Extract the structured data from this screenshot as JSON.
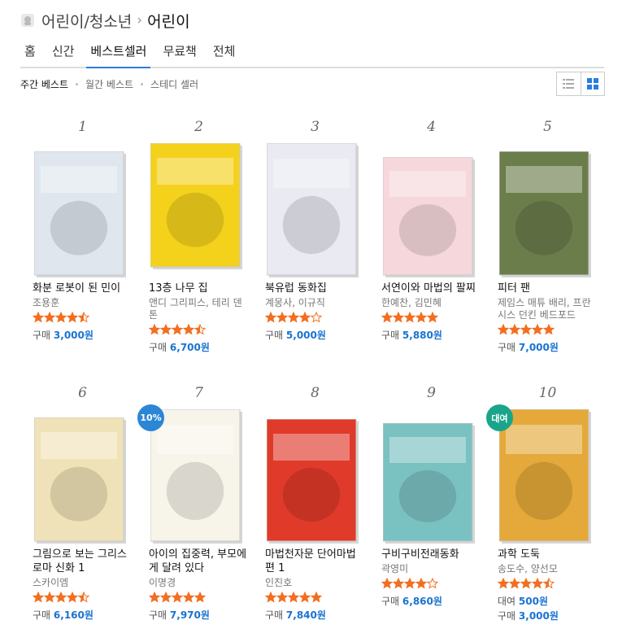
{
  "breadcrumb": {
    "parent": "어린이/청소년",
    "current": "어린이"
  },
  "tabs": [
    "홈",
    "신간",
    "베스트셀러",
    "무료책",
    "전체"
  ],
  "active_tab": 2,
  "subnav": [
    "주간 베스트",
    "월간 베스트",
    "스테디 셀러"
  ],
  "active_sub": 0,
  "view_modes": [
    "list-view-icon",
    "grid-view-icon"
  ],
  "active_view": 1,
  "price_label": "구매",
  "rent_label": "대여",
  "accent": "#1a73d0",
  "star_color": "#f26f21",
  "books": [
    {
      "rank": "1",
      "title": "화분 로봇이 된 민이",
      "author": "조용훈",
      "rating": 4.5,
      "price": "3,000원",
      "cover": "#dfe6ee"
    },
    {
      "rank": "2",
      "title": "13층 나무 집",
      "author": "앤디 그리피스, 테리 덴톤",
      "rating": 4.5,
      "price": "6,700원",
      "cover": "#f4d21c"
    },
    {
      "rank": "3",
      "title": "북유럽 동화집",
      "author": "계몽사, 이규직",
      "rating": 4,
      "price": "5,000원",
      "cover": "#e9eaf2"
    },
    {
      "rank": "4",
      "title": "서연이와 마법의 팔찌",
      "author": "한예찬, 김민혜",
      "rating": 5,
      "price": "5,880원",
      "cover": "#f6d8dc"
    },
    {
      "rank": "5",
      "title": "피터 팬",
      "author": "제임스 매튜 배리, 프란시스 던킨 베드포드",
      "rating": 5,
      "price": "7,000원",
      "cover": "#6b7d4a"
    },
    {
      "rank": "6",
      "title": "그림으로 보는 그리스 로마 신화 1",
      "author": "스카이엠",
      "rating": 4.5,
      "price": "6,160원",
      "cover": "#f0e2b8"
    },
    {
      "rank": "7",
      "title": "아이의 집중력, 부모에게 달려 있다",
      "author": "이명경",
      "rating": 5,
      "price": "7,970원",
      "cover": "#f7f4ea",
      "badge": "10%",
      "badge_color": "#2b86d6"
    },
    {
      "rank": "8",
      "title": "마법천자문 단어마법 편 1",
      "author": "인진호",
      "rating": 5,
      "price": "7,840원",
      "cover": "#e03a2a"
    },
    {
      "rank": "9",
      "title": "구비구비전래동화",
      "author": "곽영미",
      "rating": 4,
      "price": "6,860원",
      "cover": "#7ac1c2"
    },
    {
      "rank": "10",
      "title": "과학 도둑",
      "author": "송도수, 양선모",
      "rating": 4.5,
      "rent_price": "500원",
      "price": "3,000원",
      "cover": "#e4a93a",
      "badge": "대여",
      "badge_color": "#1aa58b"
    }
  ]
}
